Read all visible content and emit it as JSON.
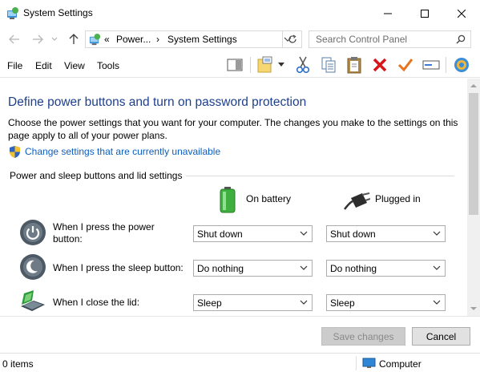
{
  "window": {
    "title": "System Settings",
    "icon": "control-panel-icon"
  },
  "address": {
    "crumbs": [
      "Power...",
      "System Settings"
    ],
    "overflow": "«",
    "separator": "›",
    "search_placeholder": "Search Control Panel"
  },
  "menu": [
    "File",
    "Edit",
    "View",
    "Tools"
  ],
  "toolbar": {
    "icons": [
      "preview-pane-icon",
      "properties-icon",
      "cut-icon",
      "copy-icon",
      "paste-icon",
      "delete-icon",
      "checkmark-icon",
      "rename-icon",
      "control-panel-icon"
    ]
  },
  "content": {
    "heading": "Define power buttons and turn on password protection",
    "description": "Choose the power settings that you want for your computer. The changes you make to the settings on this page apply to all of your power plans.",
    "change_link": "Change settings that are currently unavailable",
    "group_title": "Power and sleep buttons and lid settings",
    "columns": {
      "battery": "On battery",
      "plugged": "Plugged in"
    },
    "rows": [
      {
        "label": "When I press the power button:",
        "battery": "Shut down",
        "plugged": "Shut down",
        "icon": "power-button-icon"
      },
      {
        "label": "When I press the sleep button:",
        "battery": "Do nothing",
        "plugged": "Do nothing",
        "icon": "sleep-button-icon"
      },
      {
        "label": "When I close the lid:",
        "battery": "Sleep",
        "plugged": "Sleep",
        "icon": "laptop-lid-icon"
      }
    ]
  },
  "footer": {
    "save": "Save changes",
    "cancel": "Cancel"
  },
  "status": {
    "items": "0 items",
    "location": "Computer"
  },
  "colors": {
    "heading": "#1e3f8c",
    "link": "#0b5ec0",
    "delete": "#d8161a",
    "check": "#e8731d"
  }
}
